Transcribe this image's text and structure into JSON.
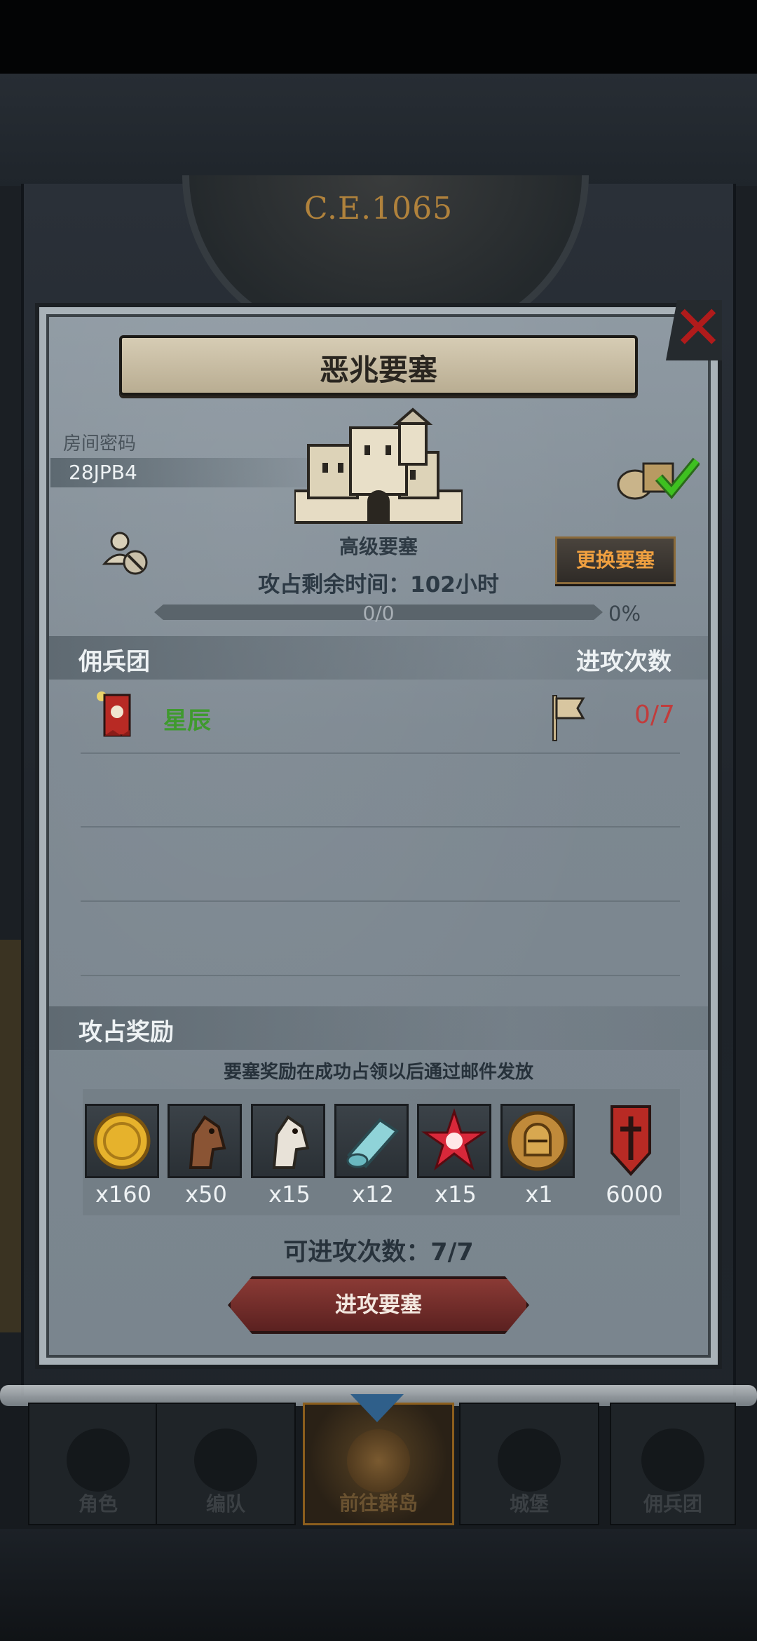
{
  "background": {
    "era": "C.E.1065"
  },
  "dialog": {
    "title": "恶兆要塞",
    "close_icon": "close-icon",
    "room": {
      "label": "房间密码",
      "code": "28JPB4"
    },
    "fortress_level": "高级要塞",
    "change_button": "更换要塞",
    "time_remaining": "攻占剩余时间：102小时",
    "progress": {
      "text": "0/0",
      "percent_text": "0%",
      "fraction": 0
    },
    "mercenary_section": {
      "title": "佣兵团",
      "right_title": "进攻次数"
    },
    "mercenaries": [
      {
        "name": "星辰",
        "attacks": "0/7"
      }
    ],
    "reward_section": {
      "title": "攻占奖励",
      "note": "要塞奖励在成功占领以后通过邮件发放"
    },
    "rewards": [
      {
        "icon": "gold-coin-icon",
        "qty": "x160"
      },
      {
        "icon": "brown-horse-icon",
        "qty": "x50"
      },
      {
        "icon": "white-horse-icon",
        "qty": "x15"
      },
      {
        "icon": "cloth-roll-icon",
        "qty": "x12"
      },
      {
        "icon": "red-star-crystal-icon",
        "qty": "x15"
      },
      {
        "icon": "knight-helmet-medal-icon",
        "qty": "x1"
      },
      {
        "icon": "red-shield-banner-icon",
        "qty": "6000"
      }
    ],
    "attempts_text": "可进攻次数：7/7",
    "attack_button": "进攻要塞"
  },
  "nav": {
    "items": [
      {
        "label": "角色",
        "icon": "knight-icon"
      },
      {
        "label": "编队",
        "icon": "helmet-icon"
      },
      {
        "label": "前往群岛",
        "icon": "map-compass-icon"
      },
      {
        "label": "城堡",
        "icon": "castle-icon"
      },
      {
        "label": "佣兵团",
        "icon": "sword-arm-icon"
      }
    ]
  },
  "colors": {
    "accent_orange": "#f0a040",
    "merc_green": "#3f9a2e",
    "count_red": "#c13c3c",
    "close_red": "#b01b1b"
  }
}
